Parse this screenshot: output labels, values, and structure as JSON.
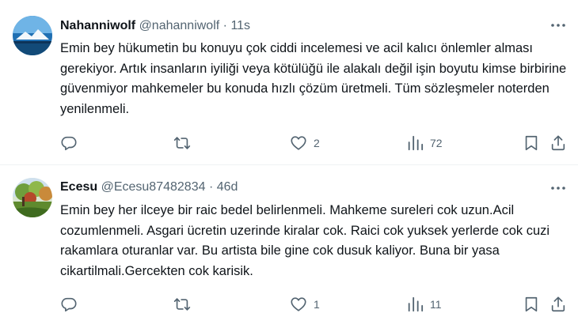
{
  "tweets": [
    {
      "name": "Nahanniwolf",
      "handle": "@nahanniwolf",
      "separator": "·",
      "time": "11s",
      "text": "Emin bey hükumetin bu konuyu çok ciddi incelemesi ve acil kalıcı önlemler alması gerekiyor. Artık insanların iyiliği veya kötülüğü ile alakalı değil işin boyutu kimse birbirine güvenmiyor mahkemeler bu konuda hızlı çözüm üretmeli. Tüm sözleşmeler noterden yenilenmeli.",
      "reply_count": "",
      "retweet_count": "",
      "like_count": "2",
      "view_count": "72"
    },
    {
      "name": "Ecesu",
      "handle": "@Ecesu87482834",
      "separator": "·",
      "time": "46d",
      "text": "Emin bey her ilceye bir raic bedel belirlenmeli. Mahkeme sureleri cok uzun.Acil cozumlenmeli. Asgari ücretin uzerinde kiralar cok. Raici cok yuksek yerlerde cok cuzi rakamlara oturanlar var. Bu artista bile gine cok dusuk kaliyor. Buna bir yasa cikartilmali.Gercekten cok karisik.",
      "reply_count": "",
      "retweet_count": "",
      "like_count": "1",
      "view_count": "11"
    }
  ],
  "icons": {
    "more": "more-horizontal-icon",
    "reply": "reply-icon",
    "retweet": "retweet-icon",
    "like": "heart-icon",
    "views": "views-chart-icon",
    "bookmark": "bookmark-icon",
    "share": "share-icon"
  },
  "colors": {
    "text": "#0f1419",
    "secondary": "#536471",
    "divider": "#eff3f4"
  }
}
